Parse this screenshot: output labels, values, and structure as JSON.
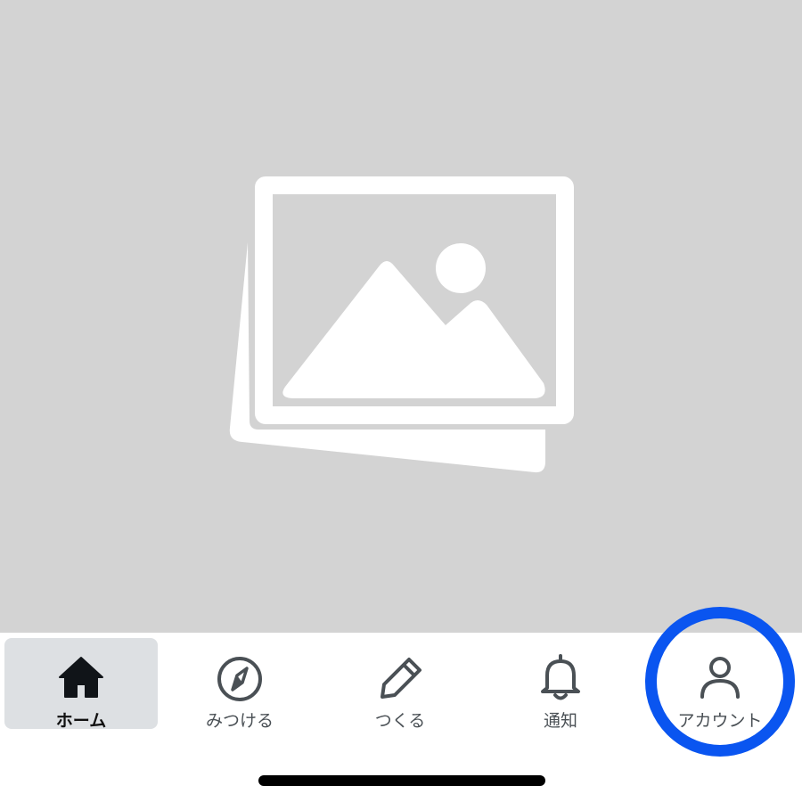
{
  "image_placeholder": {
    "icon": "image-placeholder-icon"
  },
  "tabbar": {
    "tabs": [
      {
        "label": "ホーム",
        "icon": "home-icon",
        "active": true
      },
      {
        "label": "みつける",
        "icon": "compass-icon",
        "active": false
      },
      {
        "label": "つくる",
        "icon": "pencil-icon",
        "active": false
      },
      {
        "label": "通知",
        "icon": "bell-icon",
        "active": false
      },
      {
        "label": "アカウント",
        "icon": "user-icon",
        "active": false
      }
    ]
  },
  "annotation": {
    "highlight_color": "#0a55f0",
    "highlight_target": "アカウント"
  }
}
